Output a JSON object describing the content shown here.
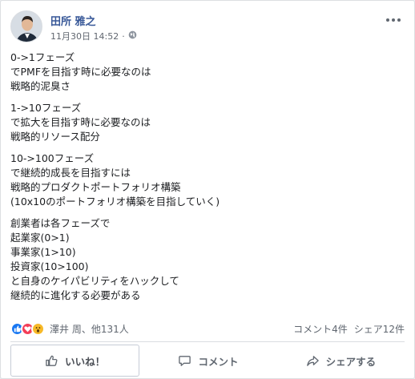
{
  "post": {
    "author": "田所 雅之",
    "timestamp": "11月30日 14:52",
    "privacy_dot": "·",
    "body_paragraphs": [
      [
        "0->1フェーズ",
        "でPMFを目指す時に必要なのは",
        "戦略的泥臭さ"
      ],
      [
        "1->10フェーズ",
        "で拡大を目指す時に必要なのは",
        "戦略的リソース配分"
      ],
      [
        "10->100フェーズ",
        "で継続的成長を目指すには",
        "戦略的プロダクトポートフォリオ構築",
        "(10x10のポートフォリオ構築を目指していく)"
      ],
      [
        "創業者は各フェーズで",
        "起業家(0>1)",
        "事業家(1>10)",
        "投資家(10>100)",
        "と自身のケイパビリティをハックして",
        "継続的に進化する必要がある"
      ]
    ]
  },
  "reactions": {
    "names": "澤井 周、他131人",
    "comments": "コメント4件",
    "shares": "シェア12件"
  },
  "actions": {
    "like": "いいね！",
    "comment": "コメント",
    "share": "シェアする"
  },
  "colors": {
    "author": "#385898",
    "like_blue": "#1877f2",
    "love_red": "#f33e58",
    "wow_yellow": "#f7b928"
  }
}
